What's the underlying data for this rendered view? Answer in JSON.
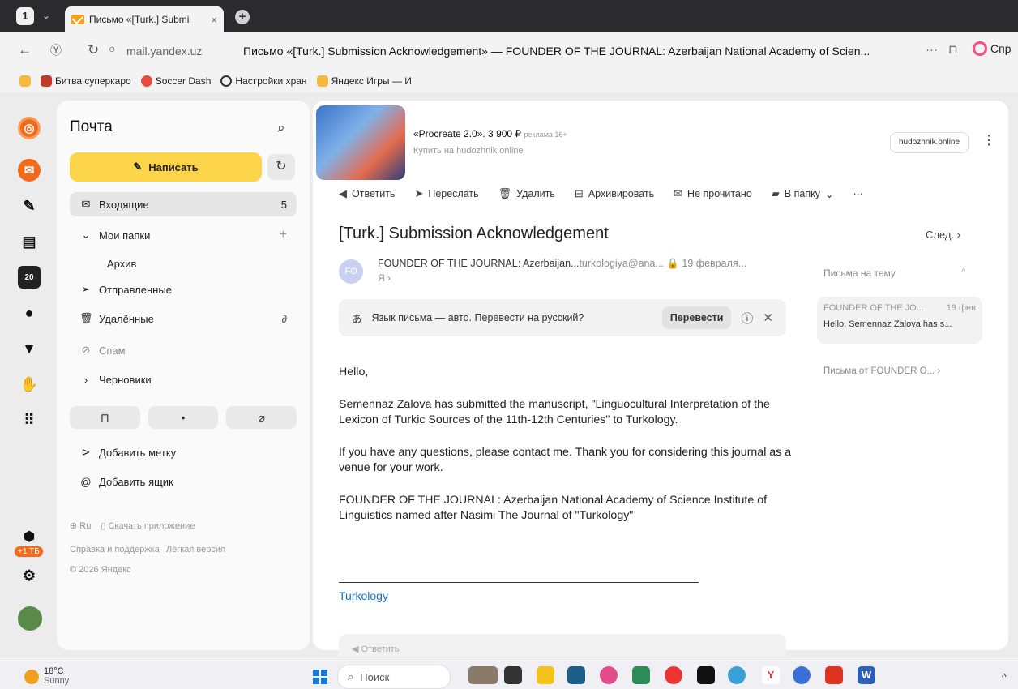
{
  "browser": {
    "tab_count": "1",
    "tab_title": "Письмо «[Turk.] Submi",
    "host": "mail.yandex.uz",
    "page_title": "Письмо «[Turk.] Submission Acknowledgement» — FOUNDER OF THE JOURNAL: Azerbaijan National Academy of Scien...",
    "alice_label": "Спр",
    "bookmarks": [
      "Битва суперкаро",
      "Soccer Dash",
      "Настройки хран",
      "Яндекс Игры — И"
    ]
  },
  "sidebar": {
    "brand": "Почта",
    "compose_label": "Написать",
    "inbox_label": "Входящие",
    "inbox_count": "5",
    "my_folders_label": "Мои папки",
    "archive_label": "Архив",
    "sent_label": "Отправленные",
    "deleted_label": "Удалённые",
    "spam_label": "Спам",
    "drafts_label": "Черновики",
    "add_label": "Добавить метку",
    "add_box": "Добавить ящик",
    "lang": "Ru",
    "download_app": "Скачать приложение",
    "help": "Справка и поддержка",
    "lite": "Лёгкая версия",
    "copyright": "© 2026 Яндекс",
    "storage_badge": "+1 ТБ"
  },
  "ad": {
    "title": "«Procreate 2.0». 3 900 ₽",
    "tag": "реклама 16+",
    "subtitle": "Купить на hudozhnik.online",
    "button": "hudozhnik.online"
  },
  "toolbar": {
    "reply": "Ответить",
    "forward": "Переслать",
    "delete": "Удалить",
    "archive": "Архивировать",
    "unread": "Не прочитано",
    "to_folder": "В папку",
    "more": "···"
  },
  "message": {
    "subject": "[Turk.] Submission Acknowledgement",
    "next": "След.",
    "avatar": "FO",
    "sender": "FOUNDER OF THE JOURNAL: Azerbaijan...",
    "address": "turkologiya@ana...",
    "date": "19 февраля...",
    "to": "Я",
    "translate_text": "Язык письма — авто. Перевести на русский?",
    "translate_btn": "Перевести",
    "greeting": "Hello,",
    "para1": "Semennaz Zalova has submitted the manuscript, \"Linguocultural Interpretation of the Lexicon of Turkic Sources of the 11th-12th Centuries\" to Turkology.",
    "para2": "If you have any questions, please contact me. Thank you for considering this journal as a venue for your work.",
    "para3": "FOUNDER OF THE JOURNAL: Azerbaijan National Academy of Science Institute of Linguistics named after Nasimi The Journal of \"Turkology\"",
    "link": "Turkology",
    "reply_placeholder": "Ответить"
  },
  "thread": {
    "header": "Письма на тему",
    "from": "FOUNDER OF THE JO...",
    "date": "19 фев",
    "snippet": "Hello, Semennaz Zalova has s...",
    "from_link": "Письма от FOUNDER O..."
  },
  "taskbar": {
    "temp": "18°C",
    "cond": "Sunny",
    "search": "Поиск"
  }
}
